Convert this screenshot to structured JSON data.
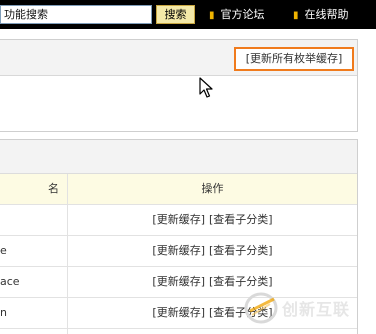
{
  "topbar": {
    "search_value": "功能搜索",
    "search_button": "搜索",
    "links": [
      "官方论坛",
      "在线帮助"
    ]
  },
  "panel1": {
    "update_all_label": "[更新所有枚举缓存]"
  },
  "table": {
    "header_name_fragment": "名",
    "header_op": "操作",
    "rows": [
      {
        "name_fragment": "",
        "update_label": "[更新缓存]",
        "view_label": "[查看子分类]"
      },
      {
        "name_fragment": "e",
        "update_label": "[更新缓存]",
        "view_label": "[查看子分类]"
      },
      {
        "name_fragment": "ace",
        "update_label": "[更新缓存]",
        "view_label": "[查看子分类]"
      },
      {
        "name_fragment": "n",
        "update_label": "[更新缓存]",
        "view_label": "[查看子分类]"
      },
      {
        "name_fragment": "",
        "update_label": "",
        "view_label": ""
      }
    ]
  },
  "watermark": {
    "text": "创新互联"
  },
  "colors": {
    "topbar_bg": "#000000",
    "highlight_border": "#f07b1d",
    "table_header_bg": "#fdfbe3",
    "panel_head_bg": "#f3f3f3",
    "bullet": "#f0b400"
  }
}
